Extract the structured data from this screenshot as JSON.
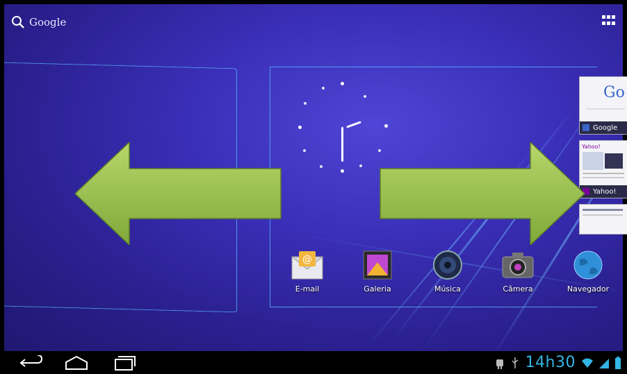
{
  "search": {
    "label": "Google"
  },
  "thumbnails": [
    {
      "label": "Google"
    },
    {
      "label": "Yahoo!"
    }
  ],
  "dock": {
    "items": [
      {
        "label": "E-mail",
        "icon": "email-icon"
      },
      {
        "label": "Galeria",
        "icon": "gallery-icon"
      },
      {
        "label": "Música",
        "icon": "music-icon"
      },
      {
        "label": "Câmera",
        "icon": "camera-icon"
      },
      {
        "label": "Navegador",
        "icon": "browser-icon"
      }
    ]
  },
  "status_bar": {
    "time": "14h30",
    "time_color": "#33b5e5"
  },
  "colors": {
    "arrow": "#9cc545",
    "accent": "#33b5e5"
  }
}
